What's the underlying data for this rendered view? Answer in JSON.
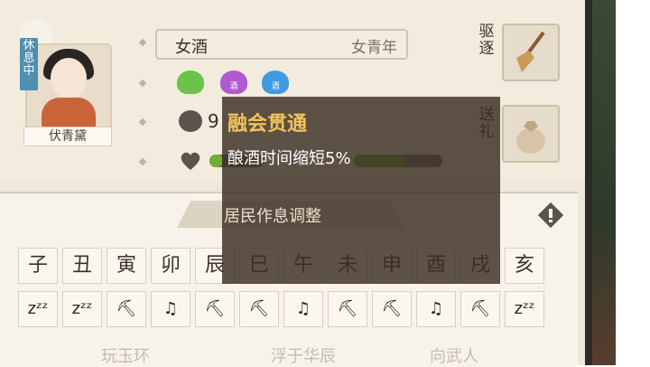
{
  "resident": {
    "status_tag": "休息中",
    "name_plate": "伏青黛",
    "name": "女酒",
    "role": "女青年",
    "stat_value": "9"
  },
  "actions": {
    "expel_label": "驱逐",
    "gift_label": "送礼"
  },
  "drink_icons": [
    {
      "label": "",
      "color": "#6cc24a"
    },
    {
      "label": "酒",
      "color": "#b05ad1"
    },
    {
      "label": "酒",
      "color": "#3f9be0"
    }
  ],
  "tooltip": {
    "title": "融会贯通",
    "description": "酿酒时间缩短5%",
    "subtitle": "居民作息调整"
  },
  "hours": [
    "子",
    "丑",
    "寅",
    "卯",
    "辰",
    "巳",
    "午",
    "未",
    "申",
    "酉",
    "戌",
    "亥"
  ],
  "schedule": [
    "sleep",
    "sleep",
    "work",
    "rest",
    "work",
    "work",
    "rest",
    "work",
    "work",
    "rest",
    "work",
    "sleep"
  ],
  "schedule_icons": {
    "sleep": "zᶻᶻ",
    "work": "⛏",
    "rest": "♫"
  },
  "bottom_labels": [
    "玩玉环",
    "浮于华辰",
    "向武人"
  ],
  "colors": {
    "accent": "#f2c15a",
    "bar_green": "#6fae37",
    "tag_blue": "#4f8fb0"
  },
  "bars": [
    {
      "fill": 0.25
    },
    {
      "fill": 0.6
    }
  ]
}
